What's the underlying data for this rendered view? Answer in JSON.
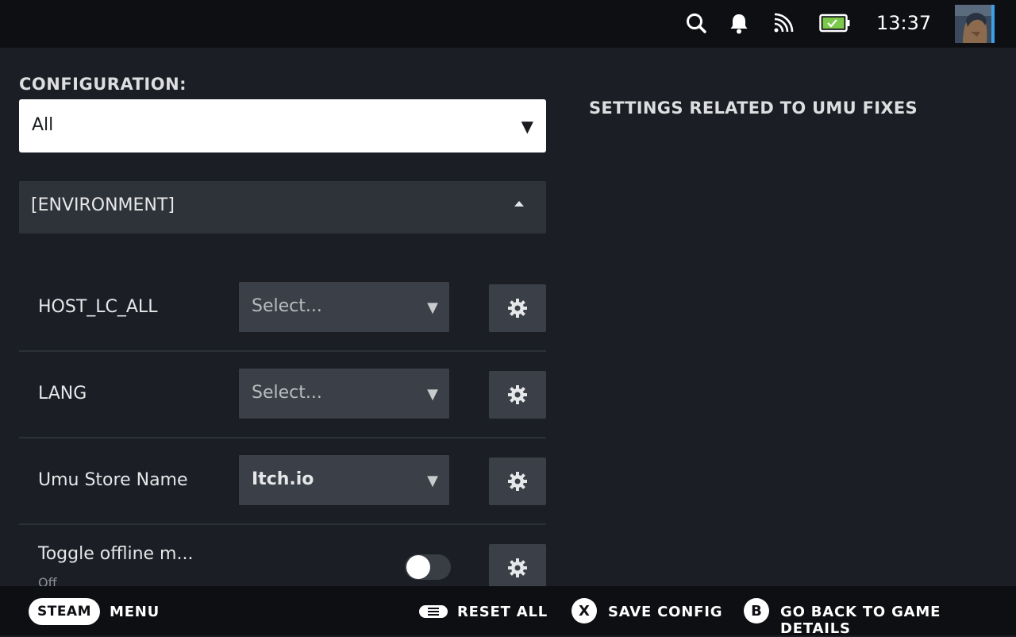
{
  "status_bar": {
    "icons": [
      "search-icon",
      "bell-icon",
      "cast-icon",
      "battery-charging-icon"
    ],
    "time": "13:37",
    "battery_color": "#7bc84a"
  },
  "config": {
    "label": "CONFIGURATION:",
    "selected": "All"
  },
  "section": {
    "title": "[ENVIRONMENT]",
    "expanded": true
  },
  "settings": [
    {
      "label": "HOST_LC_ALL",
      "value": "Select..."
    },
    {
      "label": "LANG",
      "value": "Select..."
    },
    {
      "label": "Umu Store Name",
      "value": "Itch.io"
    },
    {
      "label": "Toggle offline m...",
      "sublabel": "Off",
      "toggle_on": false
    }
  ],
  "right_panel": {
    "title": "SETTINGS RELATED TO UMU FIXES"
  },
  "footer": {
    "steam": "STEAM",
    "menu": "MENU",
    "reset": "RESET ALL",
    "save_key": "X",
    "save": "SAVE CONFIG",
    "back_key": "B",
    "back": "GO BACK TO GAME DETAILS"
  },
  "colors": {
    "background": "#1b1e25",
    "bar": "#0e0f12",
    "control": "#3b3f47"
  }
}
